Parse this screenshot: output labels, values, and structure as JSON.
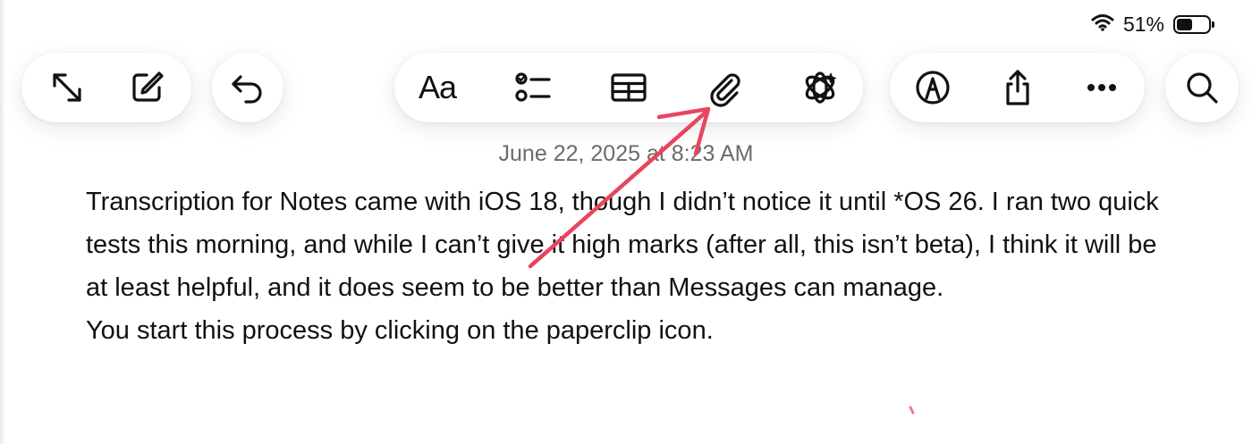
{
  "status_bar": {
    "battery_percent": "51%",
    "battery_level": 0.51,
    "wifi_icon": "wifi-icon"
  },
  "toolbar": {
    "left_group": [
      {
        "icon": "expand-arrows-icon",
        "label": "Full screen"
      },
      {
        "icon": "compose-icon",
        "label": "New note"
      }
    ],
    "undo": {
      "icon": "undo-icon"
    },
    "center_group": [
      {
        "icon": "text-format-icon",
        "text": "Aa"
      },
      {
        "icon": "checklist-icon"
      },
      {
        "icon": "table-icon"
      },
      {
        "icon": "paperclip-icon"
      },
      {
        "icon": "apple-intelligence-icon"
      }
    ],
    "right_group": [
      {
        "icon": "markup-pen-icon"
      },
      {
        "icon": "share-icon"
      },
      {
        "icon": "more-icon"
      }
    ],
    "search": {
      "icon": "search-icon"
    }
  },
  "note": {
    "timestamp": "June 22, 2025 at 8:23 AM",
    "paragraph_1": "Transcription for Notes came with iOS 18, though I didn’t notice it until *OS 26. I ran two quick tests this morning, and while I can’t give it high marks (after all, this isn’t beta), I think it will be at least helpful, and it does seem to be better than Messages can manage.",
    "paragraph_2": "You start this process by clicking on the paperclip icon."
  },
  "colors": {
    "annotation_arrow": "#e8455e",
    "timestamp_text": "#6b6b6b",
    "body_text": "#111111",
    "background": "#ffffff"
  }
}
